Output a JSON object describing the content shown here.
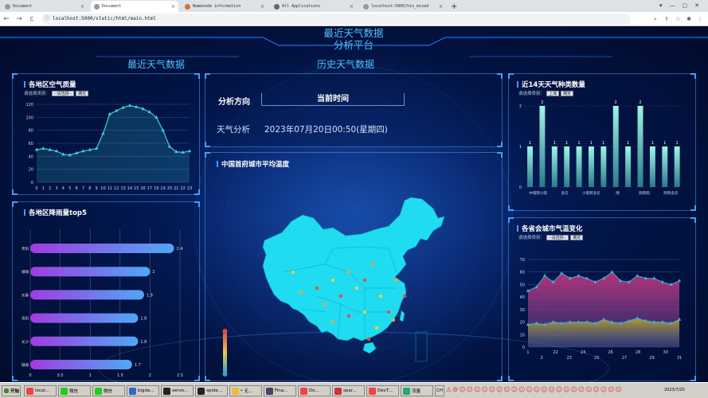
{
  "browser": {
    "tabs": [
      {
        "label": "Document",
        "active": false
      },
      {
        "label": "Document",
        "active": true
      },
      {
        "label": "Namenode information",
        "active": false
      },
      {
        "label": "All Applications",
        "active": false
      },
      {
        "label": "localhost:5000/his_mixed",
        "active": false
      }
    ],
    "new_tab": "+",
    "url": "localhost:5000/static/html/main.html",
    "nav": {
      "back": "←",
      "forward": "→",
      "reload": "C",
      "info": "ⓘ"
    }
  },
  "dashboard": {
    "title_line1": "最近天气数据",
    "title_line2": "分析平台",
    "nav_left": "最近天气数据",
    "nav_center": "历史天气数据",
    "center_info": {
      "label1": "分析方向",
      "label2": "当前时间",
      "value1": "天气分析",
      "value2": "2023年07月20日00:50(星期四)"
    },
    "map_title": "中国首府城市平均温度",
    "panels": {
      "aqi": {
        "title": "各地区空气质量",
        "filter_label": "请选择类别：",
        "select": "--请选择--",
        "button": "确定"
      },
      "rain": {
        "title": "各地区降雨量top5"
      },
      "weather_types": {
        "title": "近14天天气种类数量",
        "filter_label": "请选择类别：",
        "select": "上海",
        "button": "确定"
      },
      "temp": {
        "title": "各省会城市气温变化",
        "filter_label": "请选择类别：",
        "select": "--请选择--",
        "button": "确定"
      }
    }
  },
  "chart_data": [
    {
      "type": "area",
      "ylim": [
        0,
        120
      ],
      "yticks": [
        0,
        20,
        40,
        60,
        80,
        100,
        120
      ],
      "x": [
        "0",
        "1",
        "2",
        "3",
        "4",
        "5",
        "6",
        "7",
        "8",
        "9",
        "10",
        "11",
        "12",
        "13",
        "14",
        "15",
        "16",
        "17",
        "18",
        "19",
        "20",
        "21",
        "22",
        "23"
      ],
      "values": [
        50,
        52,
        50,
        48,
        43,
        42,
        45,
        48,
        50,
        52,
        75,
        105,
        110,
        115,
        118,
        116,
        113,
        108,
        100,
        80,
        55,
        47,
        46,
        48
      ],
      "color": "#3ad0d8"
    },
    {
      "type": "bar",
      "orientation": "horizontal",
      "categories": [
        "贵阳",
        "珊瑚",
        "长春",
        "贵阳",
        "长沙",
        "珊瑚"
      ],
      "values": [
        2.4,
        2,
        1.9,
        1.8,
        1.8,
        1.7
      ],
      "xticks": [
        0,
        0.5,
        1,
        1.5,
        2,
        2.5
      ],
      "xlim": [
        0,
        2.5
      ]
    },
    {
      "type": "bar",
      "categories": [
        "中雨转小雨",
        "多云",
        "小雨转多云",
        "晴",
        "阴转雨",
        "阴转多云"
      ],
      "values": [
        1,
        2,
        1,
        1,
        1,
        1,
        1,
        2,
        1,
        2,
        1,
        1,
        1
      ],
      "yticks": [
        0,
        1,
        2
      ],
      "ylim": [
        0,
        2
      ]
    },
    {
      "type": "area",
      "x": [
        "1",
        "2",
        "22",
        "23",
        "24",
        "25",
        "26",
        "27",
        "28",
        "29",
        "30",
        "31"
      ],
      "ylim": [
        0,
        70
      ],
      "yticks": [
        0,
        10,
        20,
        30,
        40,
        50,
        60,
        70
      ],
      "series": [
        {
          "values": [
            45,
            48,
            57,
            52,
            59,
            55,
            57,
            55,
            52,
            55,
            60,
            53,
            52,
            57,
            55,
            55,
            52,
            50,
            53
          ]
        },
        {
          "values": [
            18,
            19,
            18,
            20,
            19,
            20,
            20,
            20,
            19,
            22,
            20,
            19,
            21,
            23,
            21,
            20,
            20,
            19,
            22
          ]
        }
      ]
    },
    {
      "type": "map",
      "title": "中国首府城市平均温度"
    }
  ],
  "taskbar": {
    "start": "开始",
    "items": [
      {
        "label": "local...",
        "color": "#e44"
      },
      {
        "label": "微信",
        "color": "#2c2"
      },
      {
        "label": "微信",
        "color": "#2c2"
      },
      {
        "label": "bigda...",
        "color": "#36c"
      },
      {
        "label": "serve...",
        "color": "#222"
      },
      {
        "label": "spide...",
        "color": "#222"
      },
      {
        "label": "* 无...",
        "color": "#eb3"
      },
      {
        "label": "Fina...",
        "color": "#446"
      },
      {
        "label": "Do...",
        "color": "#e44"
      },
      {
        "label": "spar...",
        "color": "#c33"
      },
      {
        "label": "DevT...",
        "color": "#e44"
      },
      {
        "label": "流量",
        "color": "#2a7"
      }
    ],
    "lang": "CH",
    "clock": "2023/7/20"
  }
}
